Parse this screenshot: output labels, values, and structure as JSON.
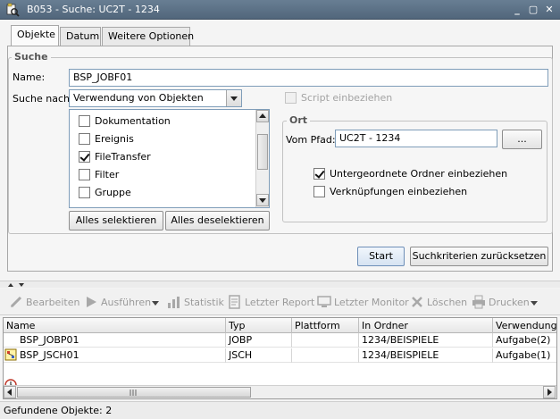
{
  "window": {
    "title": "B053 - Suche: UC2T - 1234",
    "icon": "search-document-icon",
    "controls": [
      "_",
      "▢",
      "✕"
    ]
  },
  "tabs": [
    {
      "label": "Objekte",
      "active": true
    },
    {
      "label": "Datum",
      "active": false
    },
    {
      "label": "Weitere Optionen",
      "active": false
    }
  ],
  "search": {
    "group_label": "Suche",
    "name_label": "Name:",
    "name_value": "BSP_JOBF01",
    "search_for_label": "Suche nach:",
    "search_for_value": "Verwendung von Objekten",
    "script_label": "Script einbeziehen",
    "object_types": [
      {
        "label": "Dokumentation",
        "checked": false
      },
      {
        "label": "Ereignis",
        "checked": false
      },
      {
        "label": "FileTransfer",
        "checked": true
      },
      {
        "label": "Filter",
        "checked": false
      },
      {
        "label": "Gruppe",
        "checked": false
      }
    ],
    "select_all_label": "Alles selektieren",
    "deselect_all_label": "Alles deselektieren"
  },
  "location": {
    "group_label": "Ort",
    "path_label": "Vom Pfad:",
    "path_value": "UC2T - 1234",
    "browse_label": "...",
    "subfolders_label": "Untergeordnete Ordner einbeziehen",
    "subfolders_checked": true,
    "links_label": "Verknüpfungen einbeziehen",
    "links_checked": false
  },
  "actions": {
    "start_label": "Start",
    "reset_label": "Suchkriterien zurücksetzen"
  },
  "toolbar": {
    "items": [
      {
        "label": "Bearbeiten",
        "icon": "edit-icon"
      },
      {
        "label": "Ausführen",
        "icon": "run-icon"
      },
      {
        "label": "Statistik",
        "icon": "statistics-icon"
      },
      {
        "label": "Letzter Report",
        "icon": "report-icon"
      },
      {
        "label": "Letzter Monitor",
        "icon": "monitor-icon"
      },
      {
        "label": "Löschen",
        "icon": "delete-icon"
      },
      {
        "label": "Drucken",
        "icon": "print-icon"
      }
    ]
  },
  "results": {
    "columns": [
      "Name",
      "Typ",
      "Plattform",
      "In Ordner",
      "Verwendung"
    ],
    "rows": [
      {
        "icon": "jobp-icon",
        "name": "BSP_JOBP01",
        "typ": "JOBP",
        "plattform": "",
        "ordner": "1234/BEISPIELE",
        "verwendung": "Aufgabe(2)"
      },
      {
        "icon": "jsch-icon",
        "name": "BSP_JSCH01",
        "typ": "JSCH",
        "plattform": "",
        "ordner": "1234/BEISPIELE",
        "verwendung": "Aufgabe(1)"
      }
    ]
  },
  "status": {
    "text": "Gefundene Objekte: 2"
  }
}
